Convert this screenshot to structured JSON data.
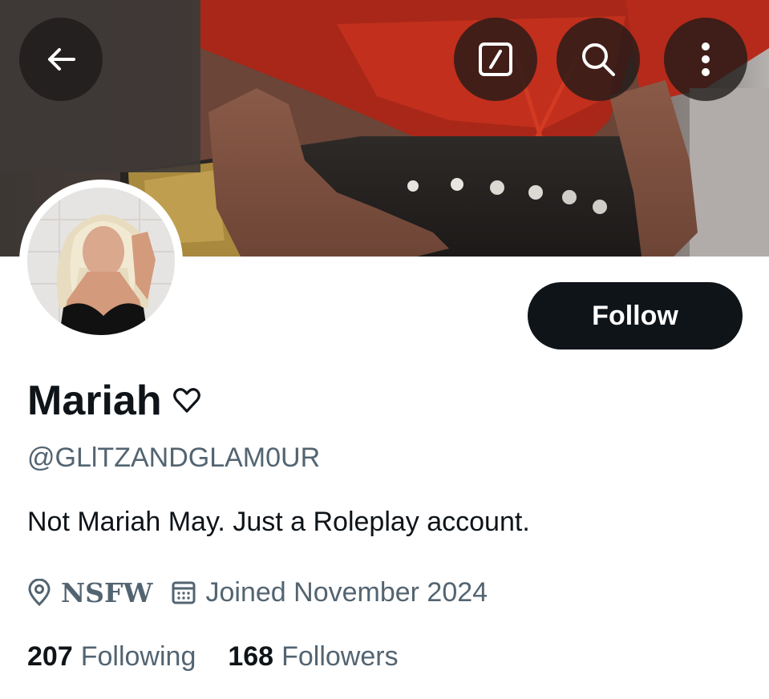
{
  "header": {
    "back_icon": "arrow-left-icon",
    "actions": [
      "compose-icon",
      "search-icon",
      "more-vertical-icon"
    ]
  },
  "profile": {
    "display_name": "Mariah",
    "name_emoji": "♡",
    "handle": "@GLlTZANDGLAM0UR",
    "follow_label": "Follow",
    "bio": "Not Mariah May. Just a Roleplay account.",
    "location": "NSFW",
    "joined": "Joined November 2024",
    "following_count": "207",
    "following_label": "Following",
    "followers_count": "168",
    "followers_label": "Followers"
  },
  "colors": {
    "text_primary": "#0f1419",
    "text_secondary": "#536471",
    "button_bg": "#0f1419",
    "button_text": "#ffffff",
    "banner_accent": "#c8321f"
  }
}
